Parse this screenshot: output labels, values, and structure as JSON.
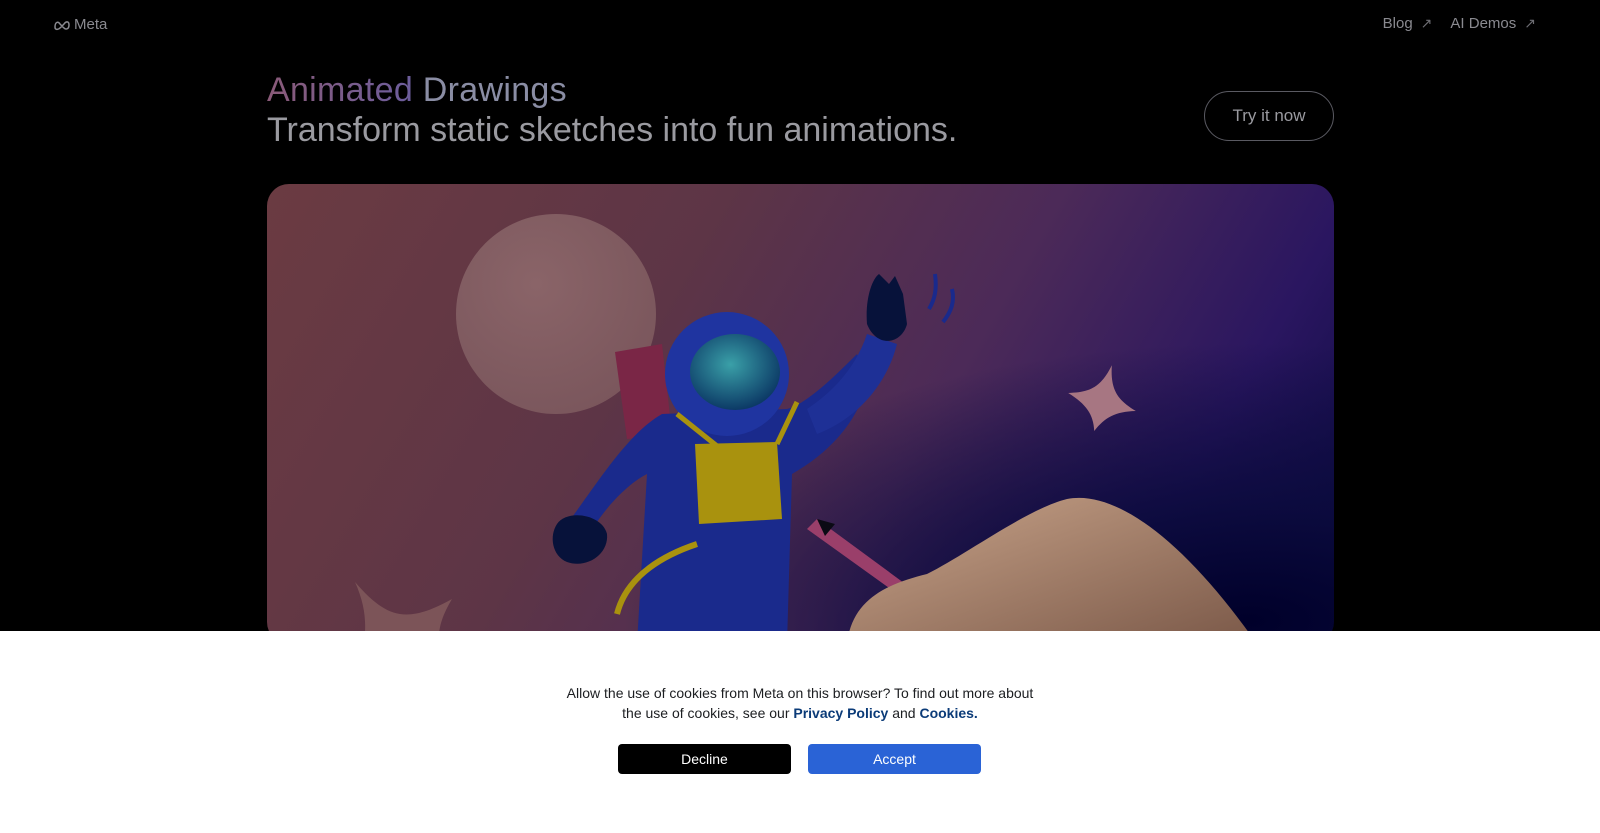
{
  "header": {
    "logo_text": "Meta",
    "nav": [
      {
        "label": "Blog",
        "icon": "external-arrow-icon"
      },
      {
        "label": "AI Demos",
        "icon": "external-arrow-icon"
      }
    ]
  },
  "hero": {
    "title_part1": "Animated",
    "title_part2": "Drawings",
    "subtitle": "Transform static sketches into fun animations.",
    "cta_label": "Try it now"
  },
  "cookie_banner": {
    "text_before": "Allow the use of cookies from Meta on this browser? To find out more about the use of cookies, see our",
    "privacy_link": "Privacy Policy",
    "and_text": "and",
    "cookies_link": "Cookies.",
    "decline_label": "Decline",
    "accept_label": "Accept"
  },
  "colors": {
    "page_background": "#000000",
    "accept_button": "#2a63d6",
    "decline_button": "#000000",
    "link": "#0b3b78"
  }
}
